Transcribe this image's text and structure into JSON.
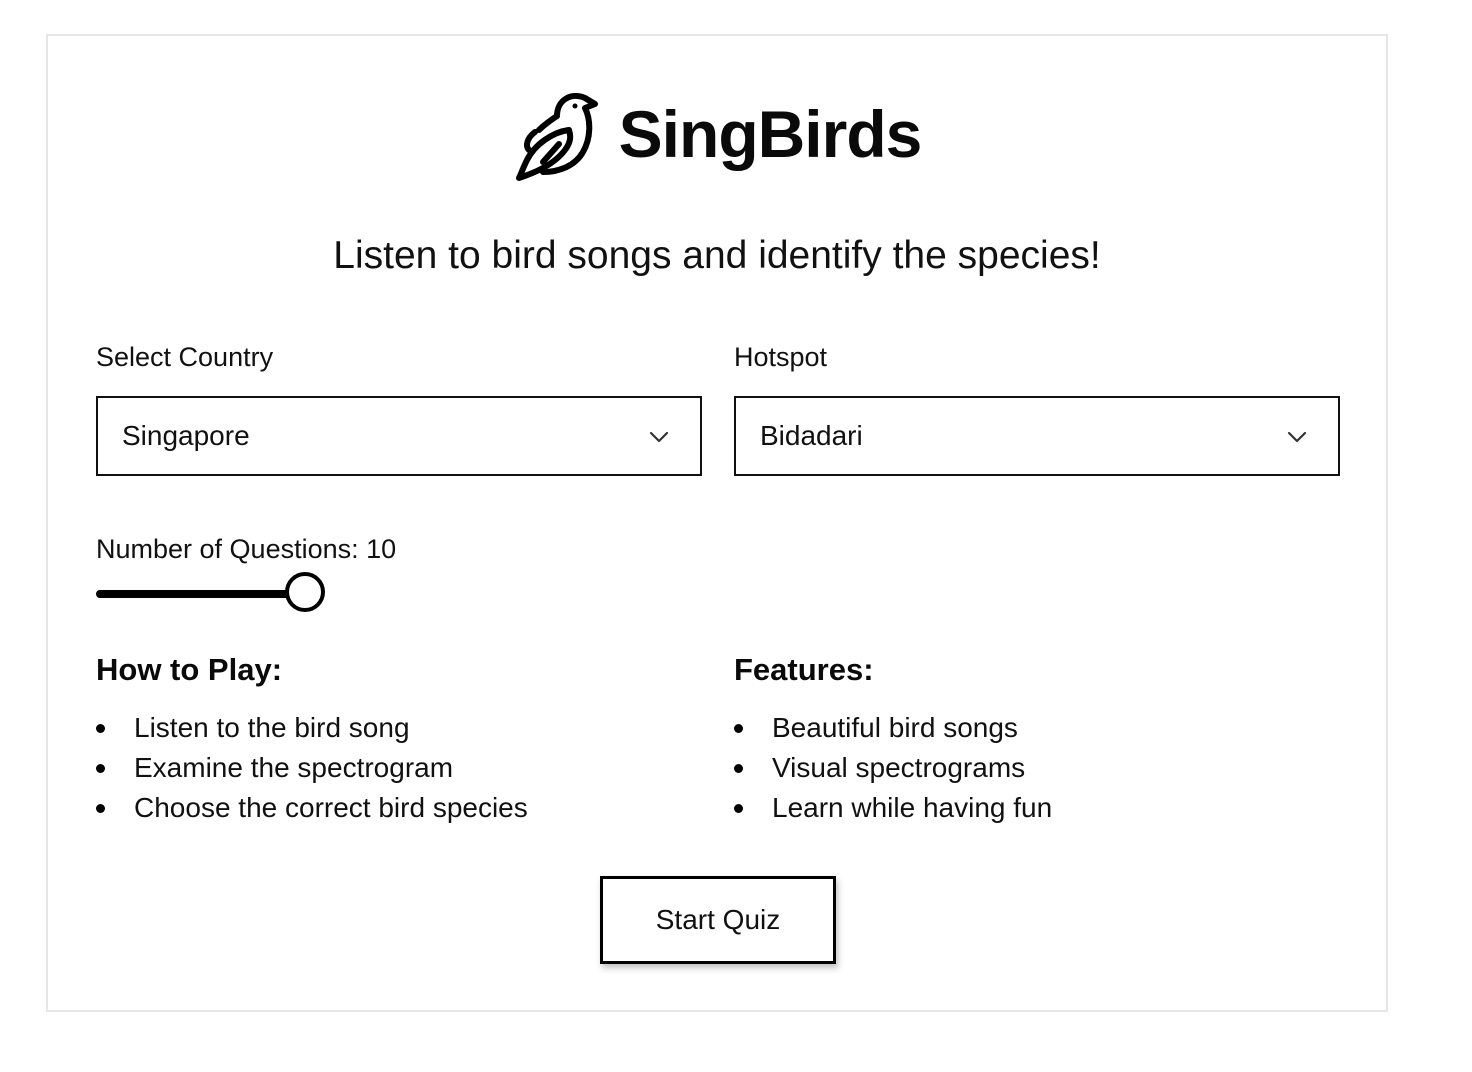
{
  "app": {
    "title": "SingBirds",
    "tagline": "Listen to bird songs and identify the species!",
    "logo_icon": "bird-icon"
  },
  "filters": {
    "country_label": "Select Country",
    "country_value": "Singapore",
    "hotspot_label": "Hotspot",
    "hotspot_value": "Bidadari"
  },
  "questions": {
    "label": "Number of Questions: 10",
    "value": 10,
    "slider_fraction": 0.9
  },
  "how_to_play": {
    "heading": "How to Play:",
    "items": [
      "Listen to the bird song",
      "Examine the spectrogram",
      "Choose the correct bird species"
    ]
  },
  "features": {
    "heading": "Features:",
    "items": [
      "Beautiful bird songs",
      "Visual spectrograms",
      "Learn while having fun"
    ]
  },
  "actions": {
    "start_label": "Start Quiz"
  },
  "icons": {
    "dropdown": "chevron-down-icon",
    "bullet": "bullet-dot-icon"
  },
  "colors": {
    "text": "#111111",
    "border": "#000000",
    "card_border": "#e6e6e6"
  }
}
